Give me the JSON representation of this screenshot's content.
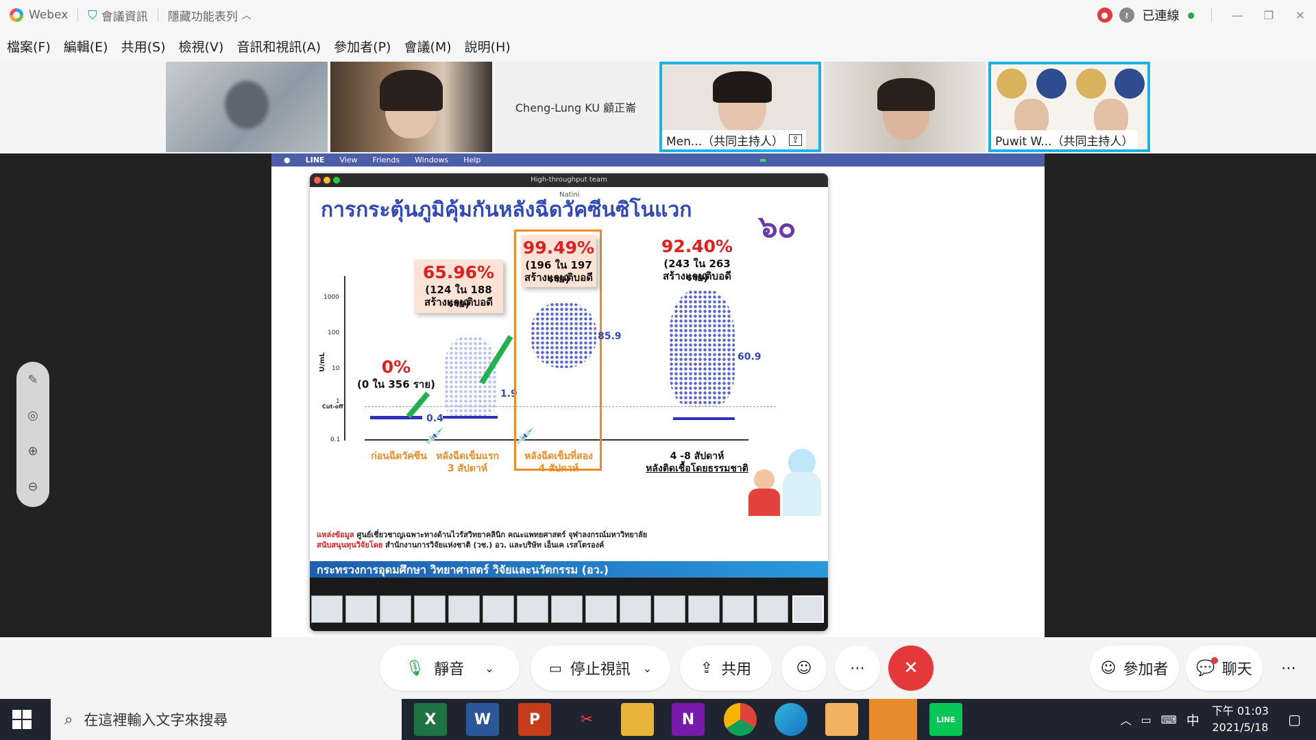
{
  "titlebar": {
    "app_name": "Webex",
    "meeting_info": "會議資訊",
    "hide_menu": "隱藏功能表列",
    "status": "已連線"
  },
  "menu": [
    "檔案(F)",
    "編輯(E)",
    "共用(S)",
    "檢視(V)",
    "音訊和視訊(A)",
    "參加者(P)",
    "會議(M)",
    "說明(H)"
  ],
  "participants": {
    "name_only": "Cheng-Lung KU 顧正崙",
    "cohost1": "Men...（共同主持人）",
    "cohost2": "Puwit W...（共同主持人）"
  },
  "mac": {
    "menu": [
      "LINE",
      "View",
      "Friends",
      "Windows",
      "Help"
    ],
    "window_title": "High-throughput team",
    "overlay_name": "Natini"
  },
  "slide": {
    "title": "การกระตุ้นภูมิคุ้มกันหลังฉีดวัคซีนซิโนแวก",
    "groups": [
      {
        "pct": "0%",
        "detail": "(0 ใน 356 ราย)",
        "label": "ก่อนฉีดวัคซีน",
        "value": "0.4"
      },
      {
        "pct": "65.96%",
        "detail": "(124 ใน 188 ราย)",
        "detail2": "สร้างแอนติบอดี",
        "label": "หลังฉีดเข็มแรก",
        "label2": "3 สัปดาห์",
        "value": "1.9"
      },
      {
        "pct": "99.49%",
        "detail": "(196 ใน 197 ราย)",
        "detail2": "สร้างแอนติบอดี",
        "label": "หลังฉีดเข็มที่สอง",
        "label2": "4 สัปดาห์",
        "value": "85.9"
      },
      {
        "pct": "92.40%",
        "detail": "(243 ใน 263 ราย)",
        "detail2": "สร้างแอนติบอดี",
        "label": "4 -8 สัปดาห์",
        "label2": "หลังติดเชื้อโดยธรรมชาติ",
        "value": "60.9"
      }
    ],
    "y_axis": {
      "label": "U/mL",
      "ticks": [
        "1000",
        "100",
        "10",
        "1",
        "Cut-off",
        "0.1"
      ]
    },
    "source_label": "แหล่งข้อมูล",
    "source_text": "ศูนย์เชี่ยวชาญเฉพาะทางด้านไวรัสวิทยาคลินิก คณะแพทยศาสตร์ จุฬาลงกรณ์มหาวิทยาลัย",
    "funding_label": "สนับสนุนทุนวิจัยโดย",
    "funding_text": "สำนักงานการวิจัยแห่งชาติ (วช.) อว. และบริษัท เอ็นเค เรสโตรองค์",
    "ministry": "กระทรวงการอุดมศึกษา วิทยาศาสตร์ วิจัยและนวัตกรรม (อว.)"
  },
  "controls": {
    "mute": "靜音",
    "stop_video": "停止視訊",
    "share": "共用",
    "participants": "參加者",
    "chat": "聊天"
  },
  "taskbar": {
    "search_placeholder": "在這裡輸入文字來搜尋",
    "ime": "中",
    "time": "下午 01:03",
    "date": "2021/5/18"
  }
}
